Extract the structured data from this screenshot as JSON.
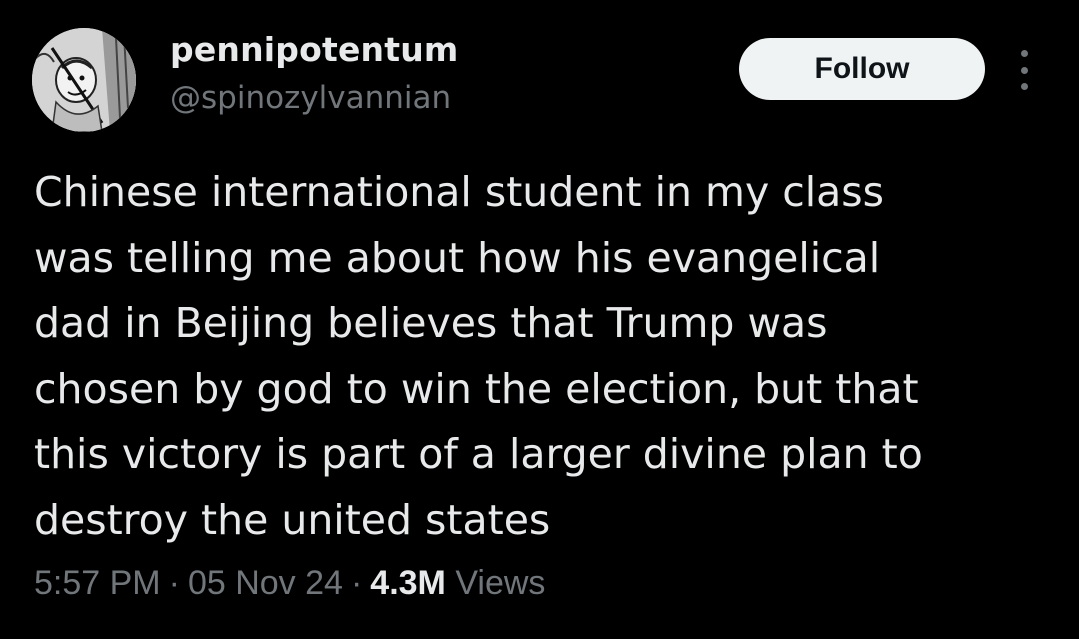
{
  "author": {
    "display_name": "pennipotentum",
    "handle": "@spinozylvannian",
    "avatar_icon": "user-avatar-sketch"
  },
  "actions": {
    "follow_label": "Follow",
    "more_icon": "more-vertical-icon"
  },
  "tweet": {
    "text": "Chinese international student in my class\nwas telling me about how his evangelical\ndad in Beijing believes that Trump was\nchosen by god to win the election, but that\nthis victory is part of a larger divine plan to\ndestroy the united states"
  },
  "meta": {
    "time": "5:57 PM",
    "separator": "·",
    "date": "05 Nov 24",
    "views_count": "4.3M",
    "views_label": "Views"
  },
  "colors": {
    "background": "#000000",
    "primary_text": "#e7e9ea",
    "secondary_text": "#71767b",
    "follow_button_bg": "#eff3f4"
  }
}
